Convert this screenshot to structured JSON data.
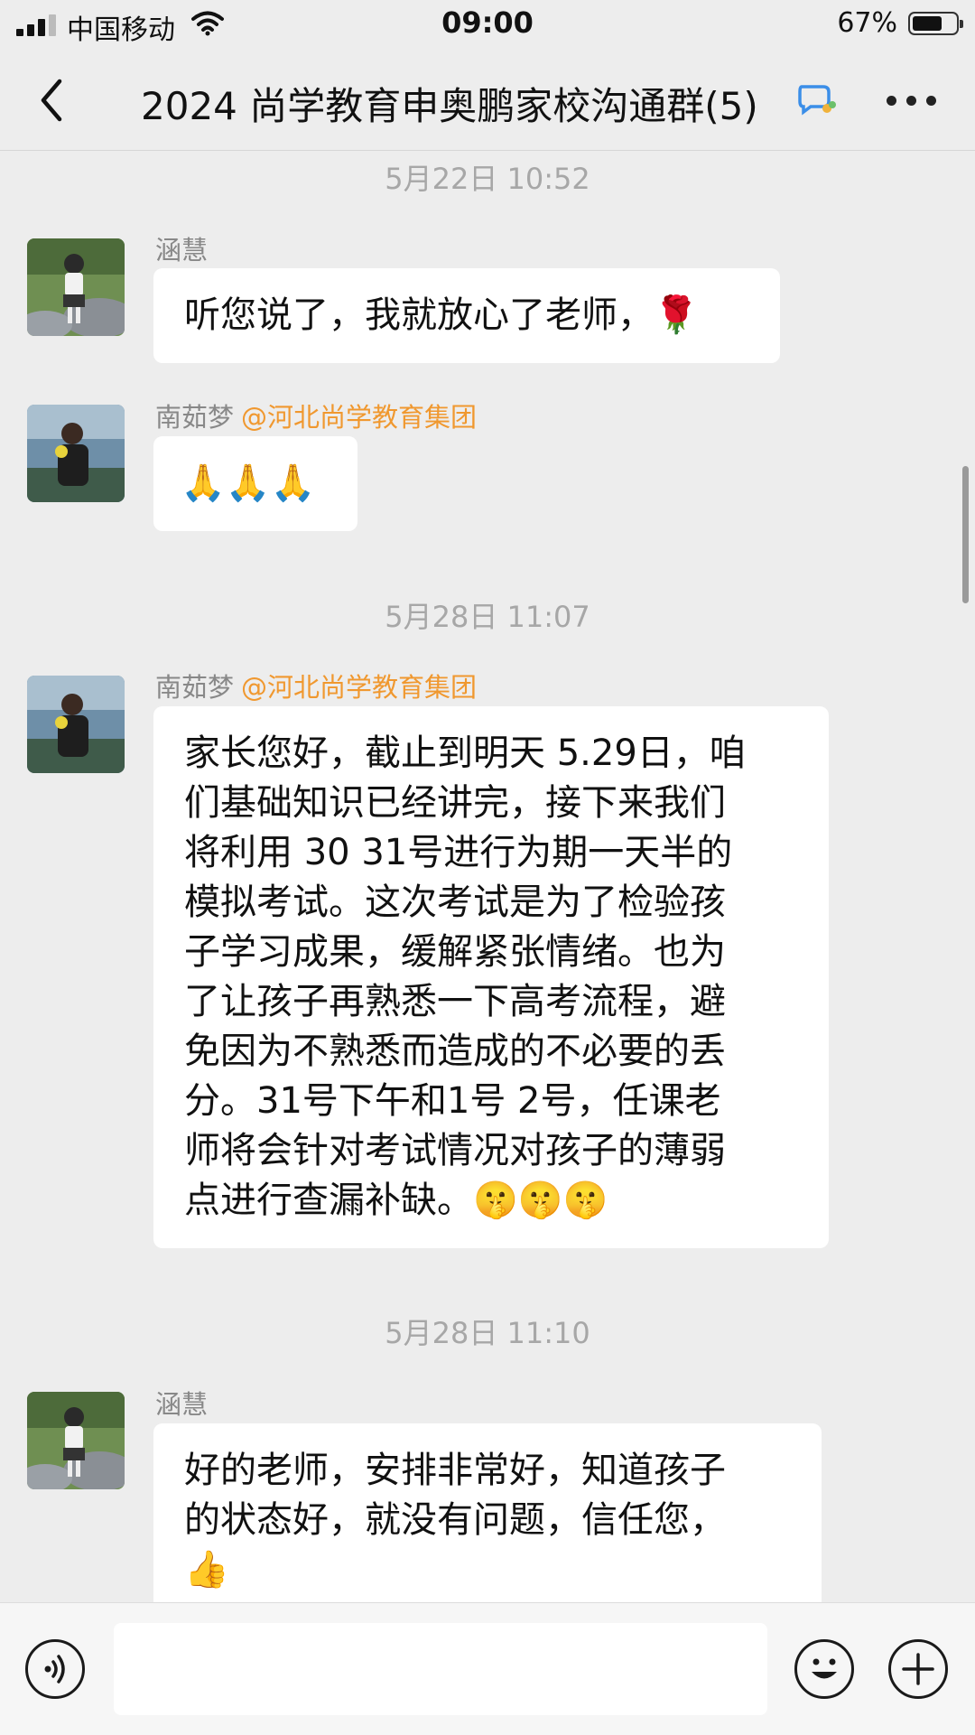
{
  "status_bar": {
    "carrier": "中国移动",
    "time": "09:00",
    "battery": "67%"
  },
  "nav": {
    "title": "2024 尚学教育申奥鹏家校沟通群(5)"
  },
  "messages": [
    {
      "type": "time",
      "text": "5月22日 10:52"
    },
    {
      "type": "msg",
      "sender": "涵慧",
      "mention": "",
      "text": "听您说了，我就放心了老师，🌹"
    },
    {
      "type": "msg",
      "sender": "南茹梦",
      "mention": "@河北尚学教育集团",
      "text": "🙏🙏🙏"
    },
    {
      "type": "time",
      "text": "5月28日 11:07"
    },
    {
      "type": "msg",
      "sender": "南茹梦",
      "mention": "@河北尚学教育集团",
      "text": "家长您好，截止到明天 5.29日，咱\n们基础知识已经讲完，接下来我们\n将利用 30 31号进行为期一天半的\n模拟考试。这次考试是为了检验孩\n子学习成果，缓解紧张情绪。也为\n了让孩子再熟悉一下高考流程，避\n免因为不熟悉而造成的不必要的丢\n分。31号下午和1号 2号，任课老\n师将会针对考试情况对孩子的薄弱\n点进行查漏补缺。🤫🤫🤫"
    },
    {
      "type": "time",
      "text": "5月28日 11:10"
    },
    {
      "type": "msg",
      "sender": "涵慧",
      "mention": "",
      "text": "好的老师，安排非常好，知道孩子\n的状态好，就没有问题，信任您，\n👍"
    }
  ],
  "input": {
    "value": "",
    "placeholder": ""
  },
  "icons": {
    "back": "chevron-left-icon",
    "chat_badge": "chat-bubble-icon",
    "more": "more-dots-icon",
    "voice": "voice-icon",
    "emoji": "emoji-icon",
    "plus": "plus-icon"
  },
  "colors": {
    "mention": "#f0982f",
    "background": "#ededed",
    "bubble": "#ffffff",
    "timestamp": "#a7a7a7"
  }
}
